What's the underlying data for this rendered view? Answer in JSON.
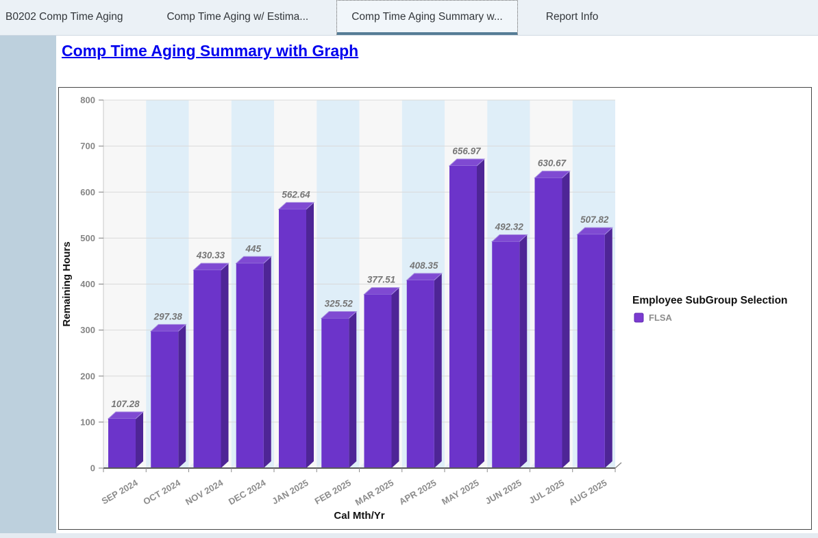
{
  "tab_bar": {
    "tabs": [
      {
        "label": "B0202 Comp Time Aging",
        "active": false
      },
      {
        "label": "Comp Time Aging w/ Estima...",
        "active": false
      },
      {
        "label": "Comp Time Aging Summary w...",
        "active": true
      },
      {
        "label": "Report Info",
        "active": false
      }
    ]
  },
  "page": {
    "title": "Comp Time Aging Summary with Graph"
  },
  "chart_data": {
    "type": "bar",
    "title": "",
    "categories": [
      "SEP 2024",
      "OCT 2024",
      "NOV 2024",
      "DEC 2024",
      "JAN 2025",
      "FEB 2025",
      "MAR 2025",
      "APR 2025",
      "MAY 2025",
      "JUN 2025",
      "JUL 2025",
      "AUG 2025"
    ],
    "series": [
      {
        "name": "FLSA",
        "values": [
          107.28,
          297.38,
          430.33,
          445,
          562.64,
          325.52,
          377.51,
          408.35,
          656.97,
          492.32,
          630.67,
          507.82
        ]
      }
    ],
    "value_labels": [
      "107.28",
      "297.38",
      "430.33",
      "445",
      "562.64",
      "325.52",
      "377.51",
      "408.35",
      "656.97",
      "492.32",
      "630.67",
      "507.82"
    ],
    "xlabel": "Cal Mth/Yr",
    "ylabel": "Remaining Hours",
    "ylim": [
      0,
      800
    ],
    "ytick_step": 100,
    "grid": true,
    "legend": {
      "position": "right",
      "title": "Employee SubGroup Selection",
      "items": [
        {
          "label": "FLSA",
          "color": "#7b3bd0"
        }
      ]
    },
    "colors": {
      "bar_front": "#6c34ca",
      "bar_top": "#7f4ad2",
      "bar_top_edge": "#a48ae0",
      "bar_side": "#4e2596",
      "band_even": "#f7f7f7",
      "band_odd": "#dfeef8",
      "gridline": "#d9d9d9",
      "axis": "#5a5a5a",
      "tick_text": "#858585",
      "value_text": "#757575",
      "floor_wedge": "#e9eef3"
    }
  },
  "colors": {
    "active_tab_underline": "#567d96",
    "title_link": "#0000ee",
    "sidebar": "#bdd0dd"
  }
}
